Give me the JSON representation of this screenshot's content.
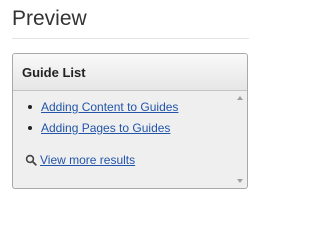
{
  "page": {
    "title": "Preview"
  },
  "widget": {
    "title": "Guide List",
    "items": [
      {
        "label": "Adding Content to Guides"
      },
      {
        "label": "Adding Pages to Guides"
      }
    ],
    "more_link": "View more results",
    "icons": {
      "search": "search-icon",
      "scroll_up": "chevron-up-icon",
      "scroll_down": "chevron-down-icon"
    }
  },
  "colors": {
    "link": "#2255aa",
    "title_text": "#333333",
    "widget_bg": "#efefef",
    "widget_border": "#a9a9a9"
  }
}
